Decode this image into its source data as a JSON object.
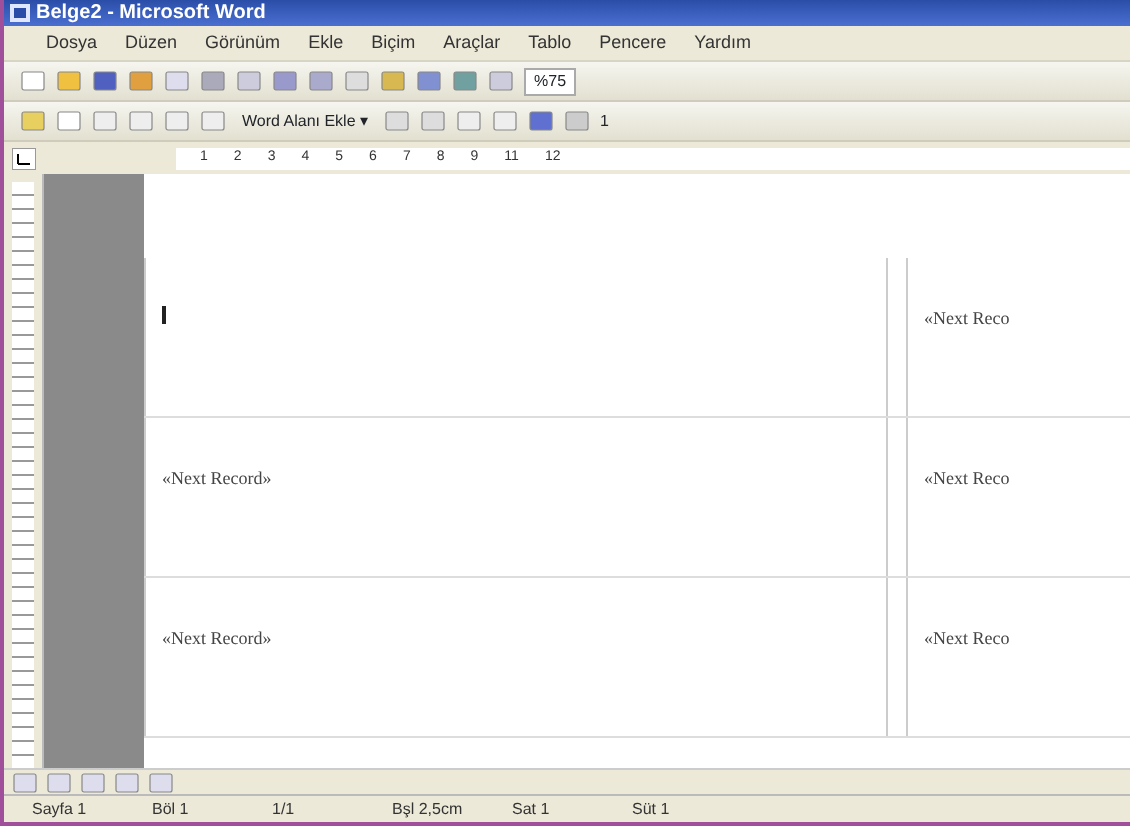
{
  "window": {
    "title": "Belge2 - Microsoft Word"
  },
  "menu": [
    "Dosya",
    "Düzen",
    "Görünüm",
    "Ekle",
    "Biçim",
    "Araçlar",
    "Tablo",
    "Pencere",
    "Yardım"
  ],
  "toolbar": {
    "zoom": "%75"
  },
  "mail_merge_toolbar": {
    "insert_field": "Word Alanı Ekle",
    "insert_field_arrow": "▾",
    "record": "1"
  },
  "ruler": [
    "1",
    "2",
    "3",
    "4",
    "5",
    "6",
    "7",
    "8",
    "9",
    "11",
    "12"
  ],
  "table": {
    "rows": [
      [
        "",
        "«Next Reco"
      ],
      [
        "«Next Record»",
        "«Next Reco"
      ],
      [
        "«Next Record»",
        "«Next Reco"
      ]
    ]
  },
  "status_bar": [
    "Sayfa 1",
    "Böl 1",
    "1/1",
    "Bşl 2,5cm",
    "Sat 1",
    "Süt 1"
  ]
}
